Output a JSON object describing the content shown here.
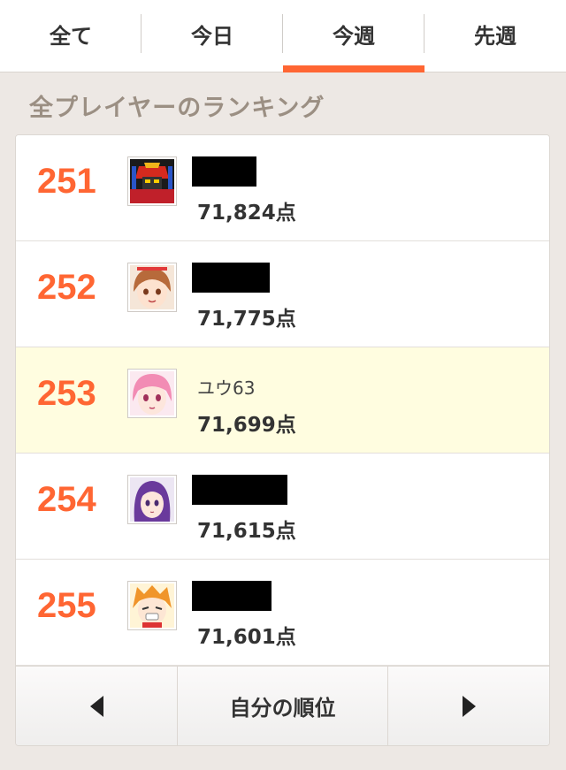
{
  "tabs": [
    {
      "label": "全て",
      "active": false
    },
    {
      "label": "今日",
      "active": false
    },
    {
      "label": "今週",
      "active": true
    },
    {
      "label": "先週",
      "active": false
    }
  ],
  "section_title": "全プレイヤーのランキング",
  "ranking": [
    {
      "rank": "251",
      "name": "",
      "name_redacted": true,
      "score": "71,824点",
      "avatar_icon": "robot-avatar-icon",
      "highlight": false
    },
    {
      "rank": "252",
      "name": "",
      "name_redacted": true,
      "score": "71,775点",
      "avatar_icon": "brown-hair-girl-avatar-icon",
      "highlight": false
    },
    {
      "rank": "253",
      "name": "ユウ63",
      "name_redacted": false,
      "score": "71,699点",
      "avatar_icon": "pink-hair-girl-avatar-icon",
      "highlight": true
    },
    {
      "rank": "254",
      "name": "",
      "name_redacted": true,
      "score": "71,615点",
      "avatar_icon": "purple-hair-girl-avatar-icon",
      "highlight": false
    },
    {
      "rank": "255",
      "name": "",
      "name_redacted": true,
      "score": "71,601点",
      "avatar_icon": "orange-hair-girl-avatar-icon",
      "highlight": false
    }
  ],
  "pager": {
    "prev_icon": "triangle-left-icon",
    "my_rank_label": "自分の順位",
    "next_icon": "triangle-right-icon"
  },
  "colors": {
    "accent": "#ff6633",
    "highlight_row": "#fffde0",
    "section_title": "#9b8f83",
    "background": "#ede8e4"
  }
}
